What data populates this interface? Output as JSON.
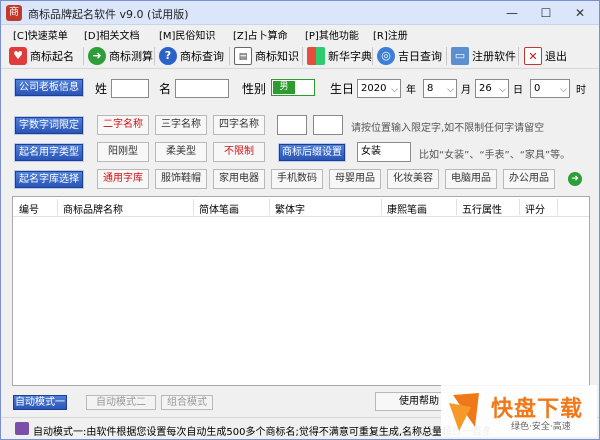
{
  "window": {
    "title": "商标品牌起名软件 v9.0 (试用版)"
  },
  "menu": [
    "[C]快速菜单",
    "[D]相关文档",
    "[M]民俗知识",
    "[Z]占卜算命",
    "[P]其他功能",
    "[R]注册"
  ],
  "toolbar": [
    "商标起名",
    "商标测算",
    "商标查询",
    "商标知识",
    "新华字典",
    "吉日查询",
    "注册软件",
    "退出"
  ],
  "owner": {
    "button": "公司老板信息",
    "surname_label": "姓",
    "name_label": "名",
    "gender_label": "性别",
    "gender_value": "男",
    "birth_label": "生日",
    "year": "2020",
    "year_unit": "年",
    "month": "8",
    "month_unit": "月",
    "day": "26",
    "day_unit": "日",
    "hour": "0",
    "hour_unit": "时"
  },
  "length_row": {
    "button": "字数字词限定",
    "options": [
      "二字名称",
      "三字名称",
      "四字名称"
    ],
    "hint": "请按位置输入限定字,如不限制任何字请留空"
  },
  "type_row": {
    "button": "起名用字类型",
    "options": [
      "阳刚型",
      "柔美型",
      "不限制"
    ],
    "suffix_button": "商标后缀设置",
    "suffix_value": "女装",
    "hint": "比如“女装”、“手表”、“家具”等。"
  },
  "library_row": {
    "button": "起名字库选择",
    "options": [
      "通用字库",
      "服饰鞋帽",
      "家用电器",
      "手机数码",
      "母婴用品",
      "化妆美容",
      "电脑用品",
      "办公用品"
    ]
  },
  "table": {
    "headers": [
      "编号",
      "商标品牌名称",
      "简体笔画",
      "繁体字",
      "康熙笔画",
      "五行属性",
      "评分"
    ]
  },
  "modes": [
    "自动模式一",
    "自动模式二",
    "组合模式"
  ],
  "help_button": "使用帮助",
  "status": {
    "text": "自动模式一:由软件根据您设置每次自动生成500多个商标名;觉得不满意可重复生成,名称总量超过一百多个亿",
    "watermark_main": "快盘下载",
    "watermark_sub": "绿色·安全·高速"
  },
  "colors": {
    "accent_blue": "#2a55b8",
    "red_text": "#d01010",
    "green_toggle": "#2f9a2f",
    "watermark_orange": "#f07818"
  }
}
